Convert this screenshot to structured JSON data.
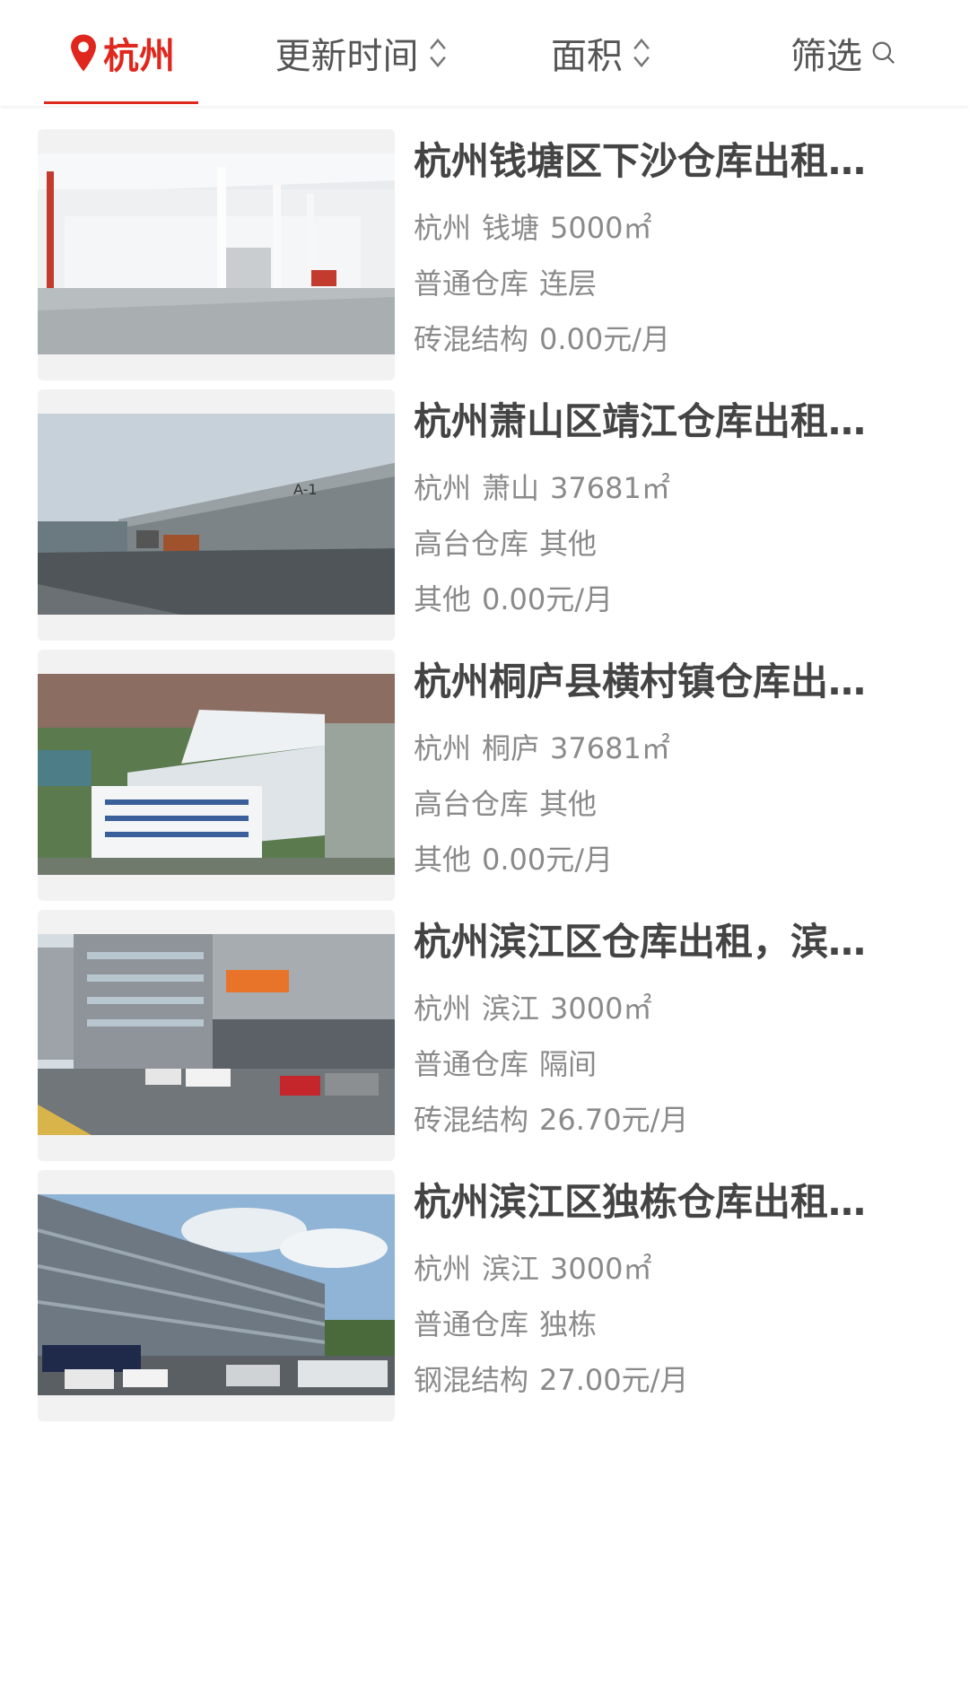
{
  "topbar": {
    "city": "杭州",
    "sort_time": "更新时间",
    "sort_area": "面积",
    "filter": "筛选"
  },
  "listings": [
    {
      "title": "杭州钱塘区下沙仓库出租…",
      "city": "杭州",
      "district": "钱塘",
      "area": "5000㎡",
      "type": "普通仓库",
      "layout": "连层",
      "structure": "砖混结构",
      "price": "0.00元/月"
    },
    {
      "title": "杭州萧山区靖江仓库出租…",
      "city": "杭州",
      "district": "萧山",
      "area": "37681㎡",
      "type": "高台仓库",
      "layout": "其他",
      "structure": "其他",
      "price": "0.00元/月"
    },
    {
      "title": "杭州桐庐县横村镇仓库出…",
      "city": "杭州",
      "district": "桐庐",
      "area": "37681㎡",
      "type": "高台仓库",
      "layout": "其他",
      "structure": "其他",
      "price": "0.00元/月"
    },
    {
      "title": "杭州滨江区仓库出租，滨…",
      "city": "杭州",
      "district": "滨江",
      "area": "3000㎡",
      "type": "普通仓库",
      "layout": "隔间",
      "structure": "砖混结构",
      "price": "26.70元/月"
    },
    {
      "title": "杭州滨江区独栋仓库出租…",
      "city": "杭州",
      "district": "滨江",
      "area": "3000㎡",
      "type": "普通仓库",
      "layout": "独栋",
      "structure": "钢混结构",
      "price": "27.00元/月"
    }
  ],
  "colors": {
    "accent": "#e0271d",
    "title": "#444444",
    "meta": "#8a8a8a"
  }
}
